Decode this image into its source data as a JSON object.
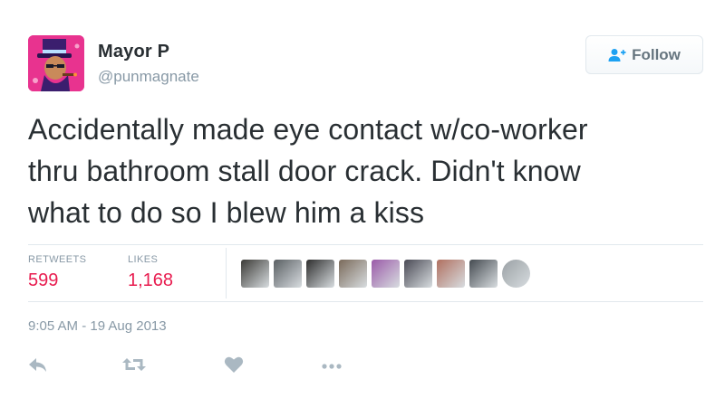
{
  "user": {
    "name": "Mayor P",
    "handle": "@punmagnate"
  },
  "follow_button": {
    "label": "Follow",
    "icon": "add-user-icon"
  },
  "tweet": {
    "lines": [
      "Accidentally made eye contact w/co-worker",
      "thru bathroom stall door crack. Didn't know",
      "what to do so I blew him a kiss"
    ]
  },
  "stats": {
    "retweets_label": "RETWEETS",
    "retweets_value": "599",
    "likes_label": "LIKES",
    "likes_value": "1,168"
  },
  "likers": [
    {
      "name": "liker-avatar-1",
      "color": "#3b3a36"
    },
    {
      "name": "liker-avatar-2",
      "color": "#5a5f63"
    },
    {
      "name": "liker-avatar-3",
      "color": "#2e2e2e"
    },
    {
      "name": "liker-avatar-4",
      "color": "#7a6a5a"
    },
    {
      "name": "liker-avatar-5",
      "color": "#9a5aa8"
    },
    {
      "name": "liker-avatar-6",
      "color": "#4a4a55"
    },
    {
      "name": "liker-avatar-7",
      "color": "#b07060"
    },
    {
      "name": "liker-avatar-8",
      "color": "#444a50"
    },
    {
      "name": "liker-avatar-9",
      "color": "#9aa0a4"
    }
  ],
  "timestamp": "9:05 AM - 19 Aug 2013",
  "actions": [
    "reply-icon",
    "retweet-icon",
    "like-icon",
    "more-icon"
  ],
  "colors": {
    "accent": "#e81c4f",
    "muted": "#8899a6",
    "text": "#292f33",
    "avatar_bg": "#e8338f"
  }
}
